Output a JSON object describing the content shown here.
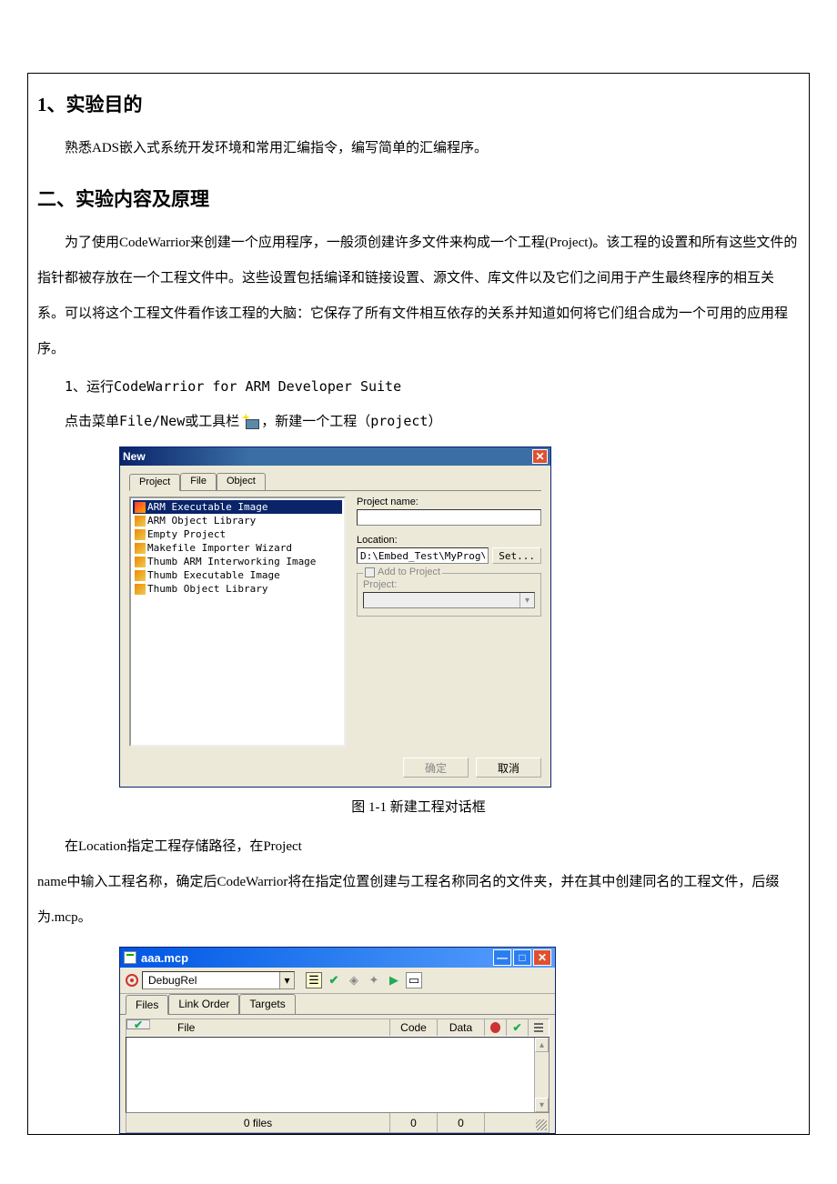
{
  "doc": {
    "heading1": "1、实验目的",
    "para1": "熟悉ADS嵌入式系统开发环境和常用汇编指令，编写简单的汇编程序。",
    "heading2": "二、实验内容及原理",
    "para2": "为了使用CodeWarrior来创建一个应用程序，一般须创建许多文件来构成一个工程(Project)。该工程的设置和所有这些文件的指针都被存放在一个工程文件中。这些设置包括编译和链接设置、源文件、库文件以及它们之间用于产生最终程序的相互关系。可以将这个工程文件看作该工程的大脑：它保存了所有文件相互依存的关系并知道如何将它们组合成为一个可用的应用程序。",
    "sub1": "1、运行CodeWarrior for ARM Developer Suite",
    "para3_a": "点击菜单File/New或工具栏",
    "para3_b": "，新建一个工程（project）",
    "fig1_caption": "图 1-1  新建工程对话框",
    "para4_a": "在Location指定工程存储路径，在Project",
    "para4_b": "name中输入工程名称，确定后CodeWarrior将在指定位置创建与工程名称同名的文件夹，并在其中创建同名的工程文件，后缀为.mcp。"
  },
  "dlg_new": {
    "title": "New",
    "tabs": {
      "project": "Project",
      "file": "File",
      "object": "Object"
    },
    "list_items": [
      "ARM Executable Image",
      "ARM Object Library",
      "Empty Project",
      "Makefile Importer Wizard",
      "Thumb ARM Interworking Image",
      "Thumb Executable Image",
      "Thumb Object Library"
    ],
    "project_name_label": "Project name:",
    "location_label": "Location:",
    "location_value": "D:\\Embed_Test\\MyProg\\",
    "set_btn": "Set...",
    "add_to_project": "Add to Project",
    "project_label": "Project:",
    "ok": "确定",
    "cancel": "取消"
  },
  "proj_win": {
    "title": "aaa.mcp",
    "target": "DebugRel",
    "tabs": {
      "files": "Files",
      "link": "Link Order",
      "targets": "Targets"
    },
    "headers": {
      "file": "File",
      "code": "Code",
      "data": "Data"
    },
    "status": {
      "files": "0 files",
      "code": "0",
      "data": "0"
    }
  }
}
